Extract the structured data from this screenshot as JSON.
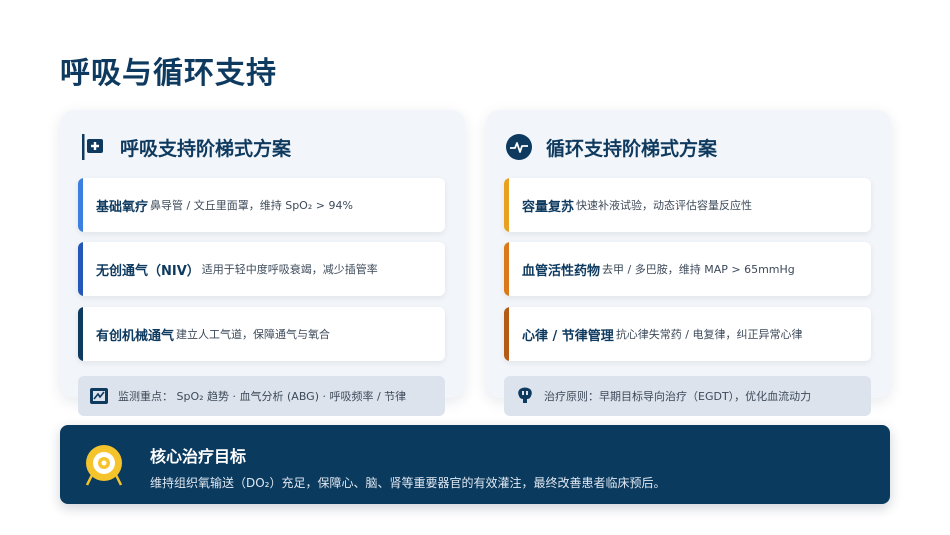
{
  "page": {
    "title": "呼吸与循环支持"
  },
  "left_panel": {
    "title": "呼吸支持阶梯式方案",
    "icon": "medical-monitor-icon",
    "cards": [
      {
        "strong": "基础氧疗",
        "desc": "鼻导管 / 文丘里面罩，维持 SpO₂ > 94%",
        "accent": "#3b7fe0"
      },
      {
        "strong": "无创通气（NIV）",
        "desc": "适用于轻中度呼吸衰竭，减少插管率",
        "accent": "#2457b8"
      },
      {
        "strong": "有创机械通气",
        "desc": "建立人工气道，保障通气与氧合",
        "accent": "#0f3a5f"
      }
    ],
    "note": {
      "icon": "monitor-chart-icon",
      "text": "监测重点： SpO₂ 趋势 · 血气分析 (ABG) · 呼吸频率 / 节律"
    }
  },
  "right_panel": {
    "title": "循环支持阶梯式方案",
    "icon": "heartbeat-icon",
    "cards": [
      {
        "strong": "容量复苏",
        "desc": "快速补液试验，动态评估容量反应性",
        "accent": "#e8a020"
      },
      {
        "strong": "血管活性药物",
        "desc": "去甲 / 多巴胺，维持 MAP > 65mmHg",
        "accent": "#d9791a"
      },
      {
        "strong": "心律 / 节律管理",
        "desc": "抗心律失常药 / 电复律，纠正异常心律",
        "accent": "#b35a14"
      }
    ],
    "note": {
      "icon": "brain-icon",
      "text": "治疗原则：早期目标导向治疗（EGDT），优化血流动力"
    }
  },
  "banner": {
    "icon": "target-icon",
    "title": "核心治疗目标",
    "text": "维持组织氧输送（DO₂）充足，保障心、脑、肾等重要器官的有效灌注，最终改善患者临床预后。"
  }
}
